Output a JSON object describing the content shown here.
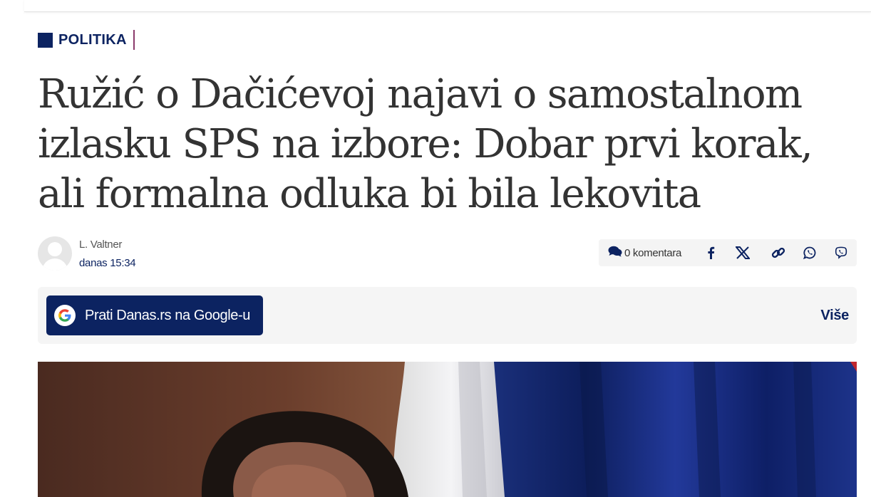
{
  "category": {
    "label": "POLITIKA"
  },
  "article": {
    "title": "Ružić o Dačićevoj najavi o samostalnom izlasku SPS na izbore: Dobar prvi korak, ali formalna odluka bi bila lekovita",
    "author": "L. Valtner",
    "date": "danas 15:34"
  },
  "share": {
    "comments_label": "0 komentara",
    "icons": [
      "comments-icon",
      "facebook-icon",
      "x-icon",
      "link-icon",
      "whatsapp-icon",
      "viber-icon"
    ]
  },
  "follow": {
    "google_label": "Prati Danas.rs na Google-u",
    "more_label": "Više"
  },
  "colors": {
    "brand_navy": "#0c2361",
    "category_divider": "#8b3a6b",
    "panel_bg": "#f5f5f5"
  }
}
